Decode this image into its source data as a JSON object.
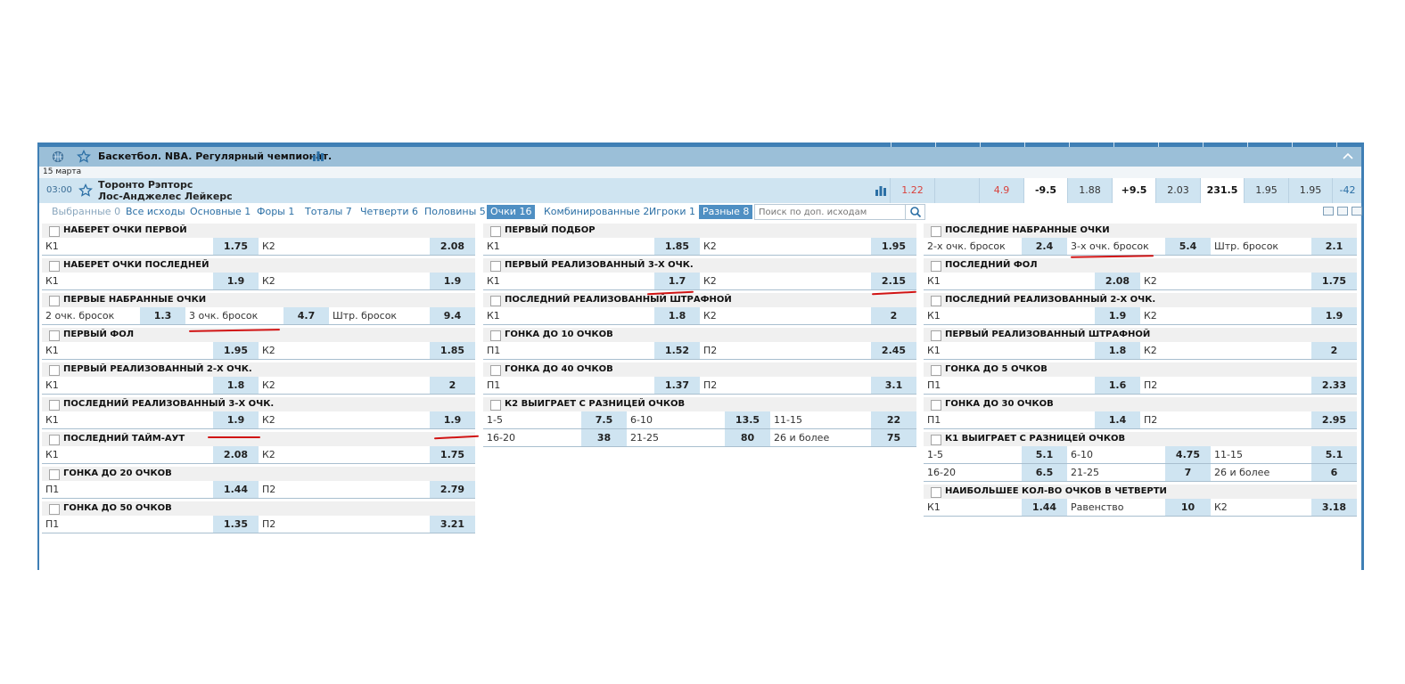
{
  "header": {
    "league_title": "Баскетбол. NBA. Регулярный чемпионат.",
    "date": "15 марта"
  },
  "event": {
    "time": "03:00",
    "team1": "Торонто Рэпторс",
    "team2": "Лос-Анджелес Лейкерс",
    "quotes": [
      "1.22",
      "",
      "4.9",
      "-9.5",
      "1.88",
      "+9.5",
      "2.03",
      "231.5",
      "1.95",
      "1.95",
      "-42"
    ]
  },
  "tabs": [
    {
      "label": "Выбранные 0",
      "state": "dim"
    },
    {
      "label": "Все исходы",
      "state": "normal"
    },
    {
      "label": "Основные 1",
      "state": "normal"
    },
    {
      "label": "Форы 1",
      "state": "normal"
    },
    {
      "label": "Тоталы 7",
      "state": "normal"
    },
    {
      "label": "Четверти 6",
      "state": "normal"
    },
    {
      "label": "Половины 5",
      "state": "normal"
    },
    {
      "label": "Очки 16",
      "state": "active"
    },
    {
      "label": "Комбинированные 2",
      "state": "normal"
    },
    {
      "label": "Игроки 1",
      "state": "normal"
    },
    {
      "label": "Разные 8",
      "state": "active"
    }
  ],
  "search": {
    "placeholder": "Поиск по доп. исходам"
  },
  "columns": [
    [
      {
        "title": "Наберет очки первой",
        "rows": [
          [
            [
              "К1",
              "1.75"
            ],
            [
              "К2",
              "2.08"
            ]
          ]
        ]
      },
      {
        "title": "Наберет очки последней",
        "rows": [
          [
            [
              "К1",
              "1.9"
            ],
            [
              "К2",
              "1.9"
            ]
          ]
        ]
      },
      {
        "title": "Первые набранные очки",
        "rows": [
          [
            [
              "2 очк. бросок",
              "1.3"
            ],
            [
              "3 очк. бросок",
              "4.7"
            ],
            [
              "Штр. бросок",
              "9.4"
            ]
          ]
        ]
      },
      {
        "title": "Первый фол",
        "rows": [
          [
            [
              "К1",
              "1.95"
            ],
            [
              "К2",
              "1.85"
            ]
          ]
        ]
      },
      {
        "title": "Первый реализованный 2-х очк.",
        "rows": [
          [
            [
              "К1",
              "1.8"
            ],
            [
              "К2",
              "2"
            ]
          ]
        ]
      },
      {
        "title": "Последний реализованный 3-х очк.",
        "rows": [
          [
            [
              "К1",
              "1.9"
            ],
            [
              "К2",
              "1.9"
            ]
          ]
        ]
      },
      {
        "title": "Последний тайм-аут",
        "rows": [
          [
            [
              "К1",
              "2.08"
            ],
            [
              "К2",
              "1.75"
            ]
          ]
        ]
      },
      {
        "title": "Гонка до 20 очков",
        "rows": [
          [
            [
              "П1",
              "1.44"
            ],
            [
              "П2",
              "2.79"
            ]
          ]
        ]
      },
      {
        "title": "Гонка до 50 очков",
        "rows": [
          [
            [
              "П1",
              "1.35"
            ],
            [
              "П2",
              "3.21"
            ]
          ]
        ]
      }
    ],
    [
      {
        "title": "Первый подбор",
        "rows": [
          [
            [
              "К1",
              "1.85"
            ],
            [
              "К2",
              "1.95"
            ]
          ]
        ]
      },
      {
        "title": "Первый реализованный 3-х очк.",
        "rows": [
          [
            [
              "К1",
              "1.7"
            ],
            [
              "К2",
              "2.15"
            ]
          ]
        ]
      },
      {
        "title": "Последний реализованный штрафной",
        "rows": [
          [
            [
              "К1",
              "1.8"
            ],
            [
              "К2",
              "2"
            ]
          ]
        ]
      },
      {
        "title": "Гонка до 10 очков",
        "rows": [
          [
            [
              "П1",
              "1.52"
            ],
            [
              "П2",
              "2.45"
            ]
          ]
        ]
      },
      {
        "title": "Гонка до 40 очков",
        "rows": [
          [
            [
              "П1",
              "1.37"
            ],
            [
              "П2",
              "3.1"
            ]
          ]
        ]
      },
      {
        "title": "К2 выиграет с разницей очков",
        "rows": [
          [
            [
              "1-5",
              "7.5"
            ],
            [
              "6-10",
              "13.5"
            ],
            [
              "11-15",
              "22"
            ]
          ],
          [
            [
              "16-20",
              "38"
            ],
            [
              "21-25",
              "80"
            ],
            [
              "26 и более",
              "75"
            ]
          ]
        ]
      }
    ],
    [
      {
        "title": "Последние набранные очки",
        "rows": [
          [
            [
              "2-х очк. бросок",
              "2.4"
            ],
            [
              "3-х очк. бросок",
              "5.4"
            ],
            [
              "Штр. бросок",
              "2.1"
            ]
          ]
        ]
      },
      {
        "title": "Последний фол",
        "rows": [
          [
            [
              "К1",
              "2.08"
            ],
            [
              "К2",
              "1.75"
            ]
          ]
        ]
      },
      {
        "title": "Последний реализованный 2-х очк.",
        "rows": [
          [
            [
              "К1",
              "1.9"
            ],
            [
              "К2",
              "1.9"
            ]
          ]
        ]
      },
      {
        "title": "Первый реализованный штрафной",
        "rows": [
          [
            [
              "К1",
              "1.8"
            ],
            [
              "К2",
              "2"
            ]
          ]
        ]
      },
      {
        "title": "Гонка до 5 очков",
        "rows": [
          [
            [
              "П1",
              "1.6"
            ],
            [
              "П2",
              "2.33"
            ]
          ]
        ]
      },
      {
        "title": "Гонка до 30 очков",
        "rows": [
          [
            [
              "П1",
              "1.4"
            ],
            [
              "П2",
              "2.95"
            ]
          ]
        ]
      },
      {
        "title": "К1 выиграет с разницей очков",
        "rows": [
          [
            [
              "1-5",
              "5.1"
            ],
            [
              "6-10",
              "4.75"
            ],
            [
              "11-15",
              "5.1"
            ]
          ],
          [
            [
              "16-20",
              "6.5"
            ],
            [
              "21-25",
              "7"
            ],
            [
              "26 и более",
              "6"
            ]
          ]
        ]
      },
      {
        "title": "Наибольшее кол-во очков в четверти",
        "rows": [
          [
            [
              "К1",
              "1.44"
            ],
            [
              "Равенство",
              "10"
            ],
            [
              "К2",
              "3.18"
            ]
          ]
        ]
      }
    ]
  ],
  "colors": {
    "frame": "#3f7fb5",
    "header": "#9bbfd8",
    "event_bg": "#cfe4f1",
    "odds_bg": "#cfe4f1",
    "accent": "#4f8fc3",
    "negative": "#d9413c",
    "annotation": "#d11414"
  }
}
